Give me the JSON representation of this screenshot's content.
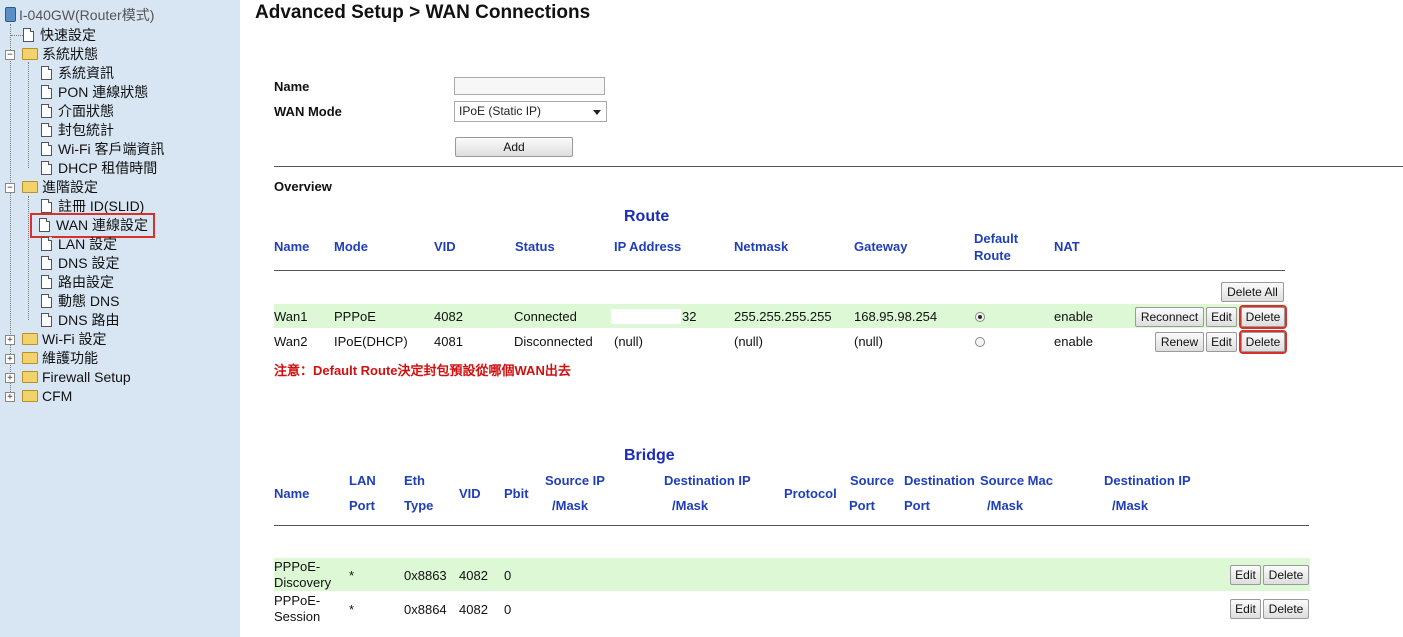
{
  "sidebar": {
    "root": "I-040GW(Router模式)",
    "items": [
      {
        "label": "快速設定"
      },
      {
        "label": "系統狀態"
      },
      {
        "label": "系統資訊"
      },
      {
        "label": "PON 連線狀態"
      },
      {
        "label": "介面狀態"
      },
      {
        "label": "封包統計"
      },
      {
        "label": "Wi-Fi 客戶端資訊"
      },
      {
        "label": "DHCP 租借時間"
      },
      {
        "label": "進階設定"
      },
      {
        "label": "註冊 ID(SLID)"
      },
      {
        "label": "WAN 連線設定"
      },
      {
        "label": "LAN 設定"
      },
      {
        "label": "DNS 設定"
      },
      {
        "label": "路由設定"
      },
      {
        "label": "動態 DNS"
      },
      {
        "label": "DNS 路由"
      },
      {
        "label": "Wi-Fi 設定"
      },
      {
        "label": "維護功能"
      },
      {
        "label": "Firewall Setup"
      },
      {
        "label": "CFM"
      }
    ]
  },
  "page": {
    "title": "Advanced Setup > WAN Connections"
  },
  "form": {
    "name_label": "Name",
    "name_value": "",
    "mode_label": "WAN Mode",
    "mode_value": "IPoE (Static IP)",
    "add_label": "Add"
  },
  "overview": {
    "label": "Overview"
  },
  "route": {
    "title": "Route",
    "headers": [
      "Name",
      "Mode",
      "VID",
      "Status",
      "IP Address",
      "Netmask",
      "Gateway",
      "Default Route",
      "NAT"
    ],
    "delete_all_label": "Delete All",
    "rows": [
      {
        "name": "Wan1",
        "mode": "PPPoE",
        "vid": "4082",
        "status": "Connected",
        "ip": "32",
        "netmask": "255.255.255.255",
        "gateway": "168.95.98.254",
        "default_route": true,
        "nat": "enable",
        "action": "Reconnect",
        "edit": "Edit",
        "delete": "Delete"
      },
      {
        "name": "Wan2",
        "mode": "IPoE(DHCP)",
        "vid": "4081",
        "status": "Disconnected",
        "ip": "(null)",
        "netmask": "(null)",
        "gateway": "(null)",
        "default_route": false,
        "nat": "enable",
        "action": "Renew",
        "edit": "Edit",
        "delete": "Delete"
      }
    ],
    "note": "注意：Default Route決定封包預設從哪個WAN出去"
  },
  "bridge": {
    "title": "Bridge",
    "headers": {
      "name": "Name",
      "lan_port": [
        "LAN",
        "Port"
      ],
      "eth_type": [
        "Eth",
        "Type"
      ],
      "vid": "VID",
      "pbit": "Pbit",
      "source_ip": [
        "Source IP",
        "/Mask"
      ],
      "dest_ip": [
        "Destination IP",
        "/Mask"
      ],
      "protocol": "Protocol",
      "source_port": [
        "Source",
        "Port"
      ],
      "dest_port": [
        "Destination",
        "Port"
      ],
      "source_mac": [
        "Source Mac",
        "/Mask"
      ],
      "dest_ip2": [
        "Destination IP",
        "/Mask"
      ]
    },
    "rows": [
      {
        "name": [
          "PPPoE-",
          "Discovery"
        ],
        "lan_port": "*",
        "eth_type": "0x8863",
        "vid": "4082",
        "pbit": "0",
        "edit": "Edit",
        "delete": "Delete"
      },
      {
        "name": [
          "PPPoE-",
          "Session"
        ],
        "lan_port": "*",
        "eth_type": "0x8864",
        "vid": "4082",
        "pbit": "0",
        "edit": "Edit",
        "delete": "Delete"
      }
    ]
  },
  "colors": {
    "sidebar_bg": "#d8e6f4",
    "header_blue": "#1f3fb8",
    "row_green": "#dcf8d4",
    "note_red": "#d20f0f",
    "highlight_red": "#d9302c"
  }
}
